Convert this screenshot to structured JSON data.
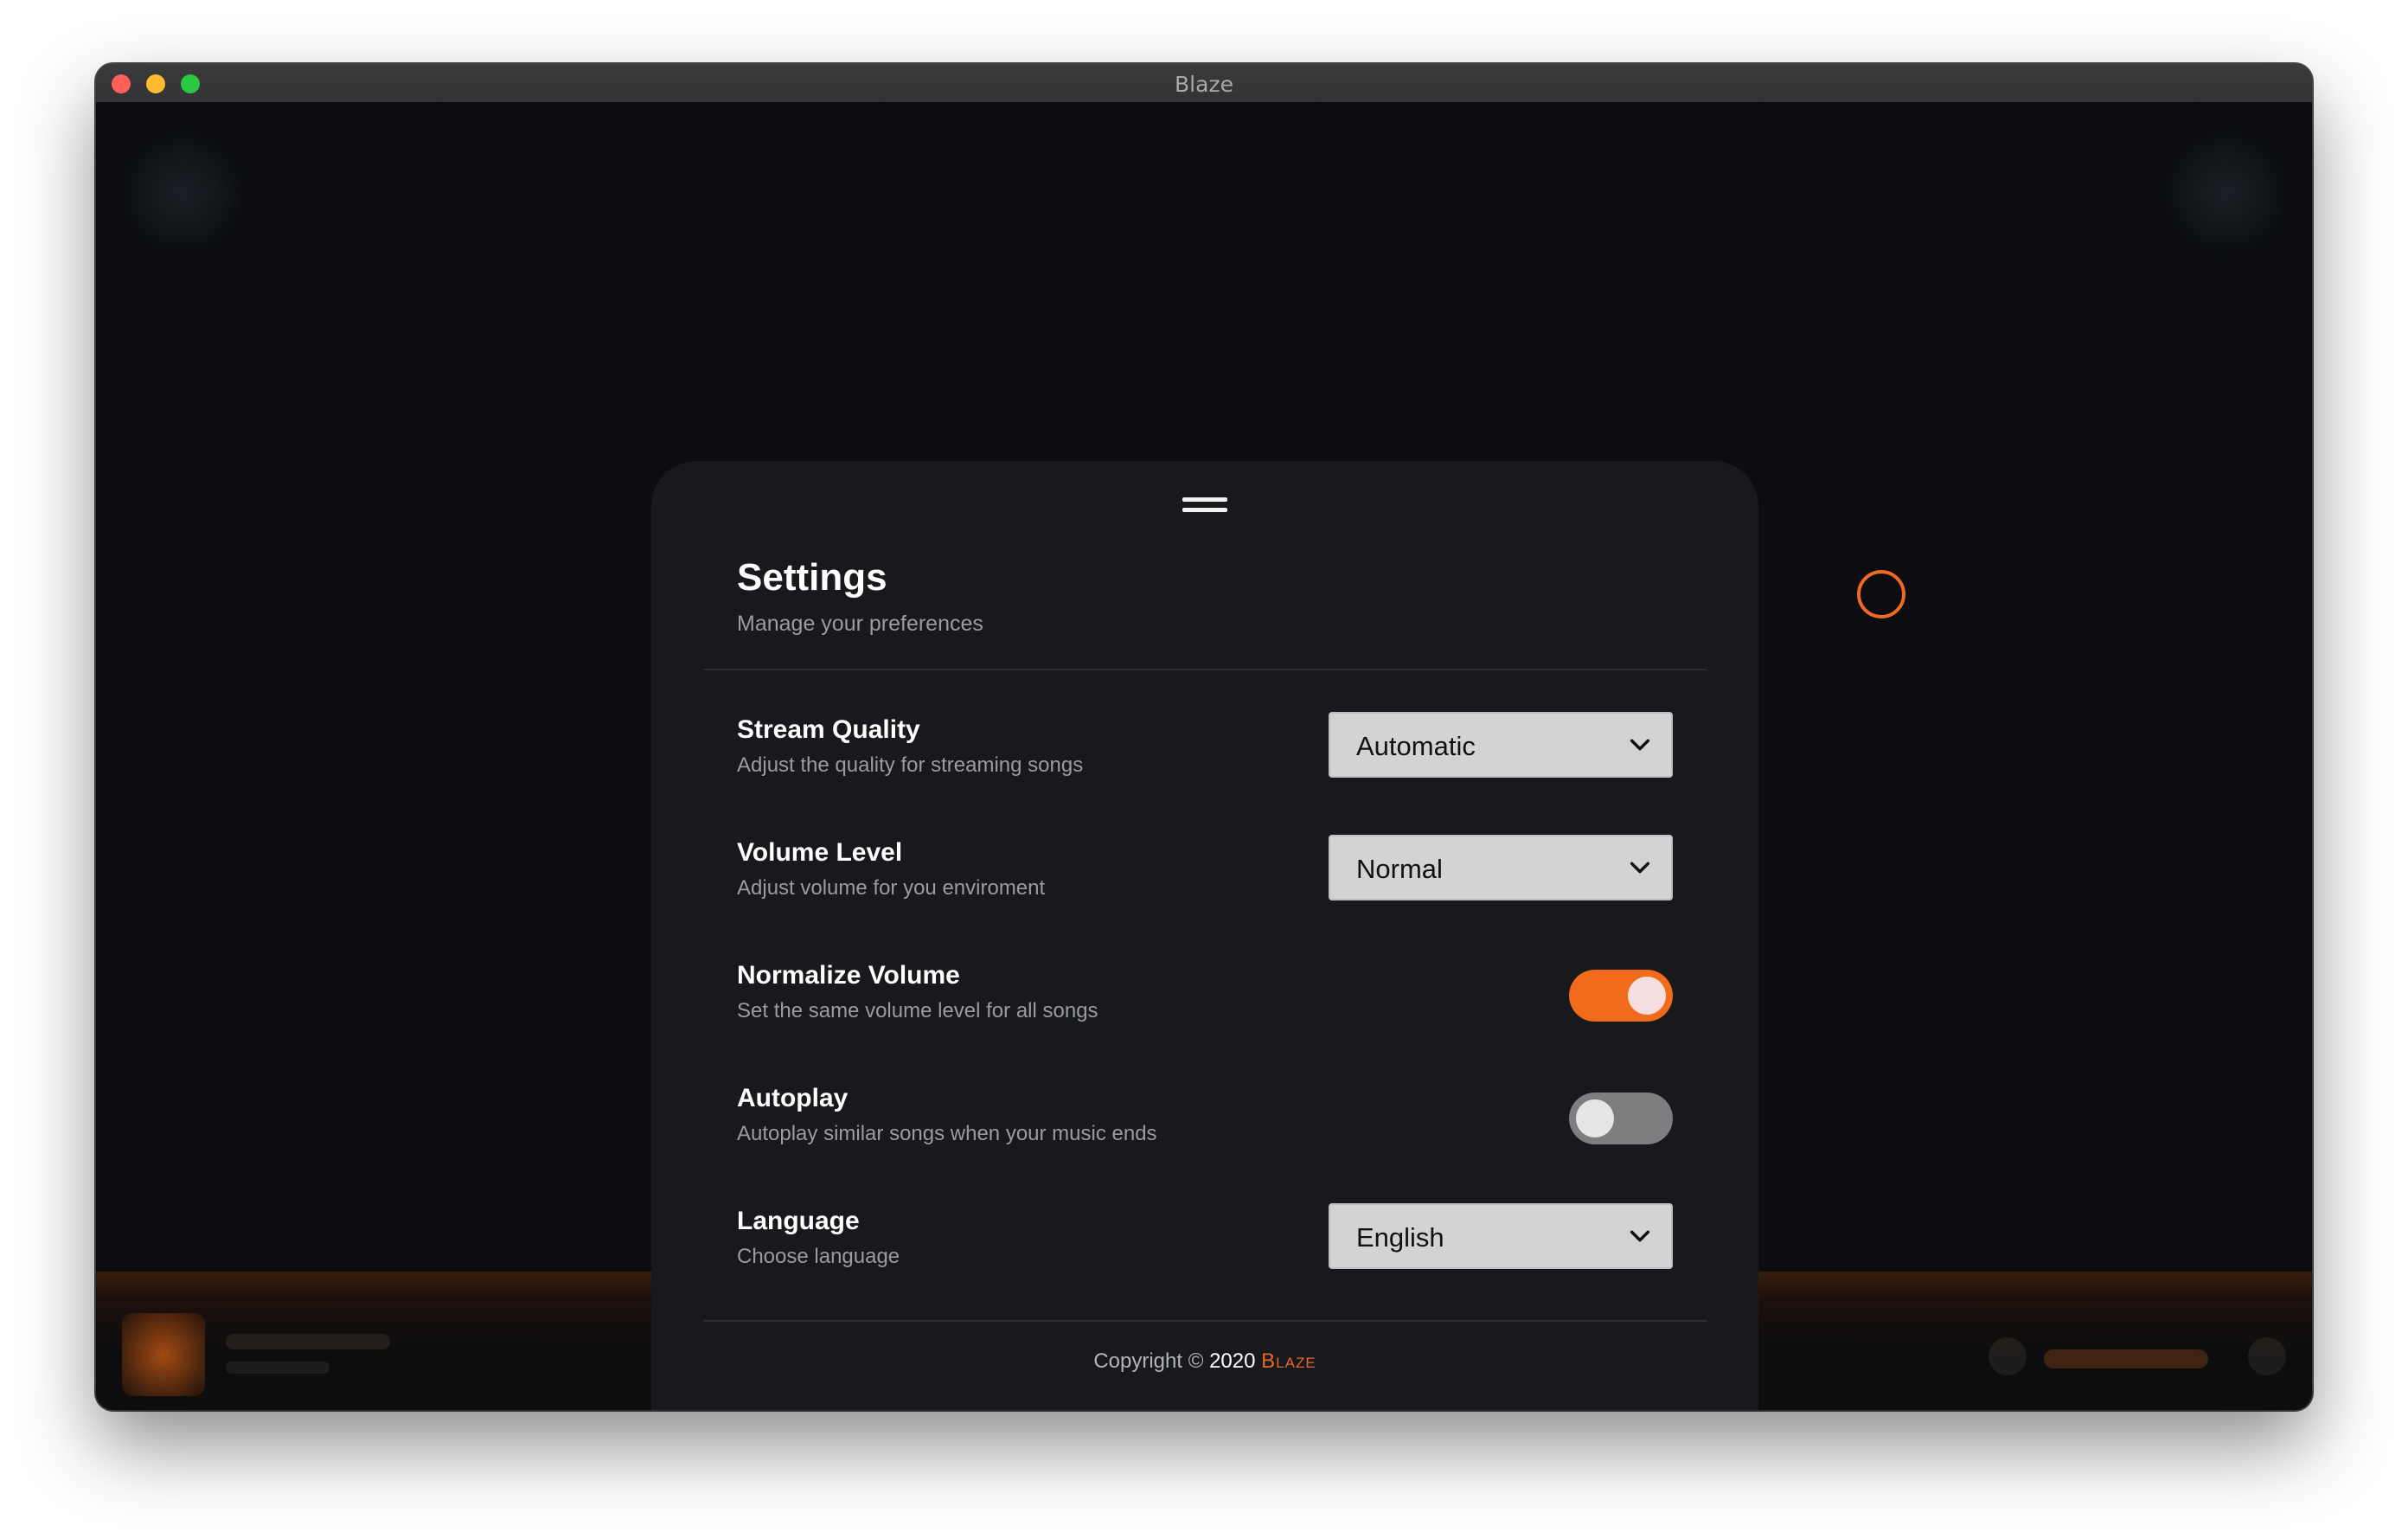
{
  "window": {
    "title": "Blaze"
  },
  "settings": {
    "title": "Settings",
    "subtitle": "Manage your preferences",
    "rows": [
      {
        "title": "Stream Quality",
        "description": "Adjust the quality for streaming songs",
        "control": "select",
        "value": "Automatic"
      },
      {
        "title": "Volume Level",
        "description": "Adjust volume for you enviroment",
        "control": "select",
        "value": "Normal"
      },
      {
        "title": "Normalize Volume",
        "description": "Set the same volume level for all songs",
        "control": "toggle",
        "enabled": true
      },
      {
        "title": "Autoplay",
        "description": "Autoplay similar songs when your music ends",
        "control": "toggle",
        "enabled": false
      },
      {
        "title": "Language",
        "description": "Choose language",
        "control": "select",
        "value": "English"
      }
    ]
  },
  "footer": {
    "copyright_prefix": "Copyright ©",
    "year": "2020",
    "brand": "Blaze"
  },
  "colors": {
    "accent": "#f26a1b",
    "panel": "#17191c",
    "background": "#0b0d11"
  },
  "icons": {
    "menu_handle": "drag-handle-icon",
    "select_caret": "chevron-down-icon",
    "cursor": "cursor-ring-icon"
  }
}
